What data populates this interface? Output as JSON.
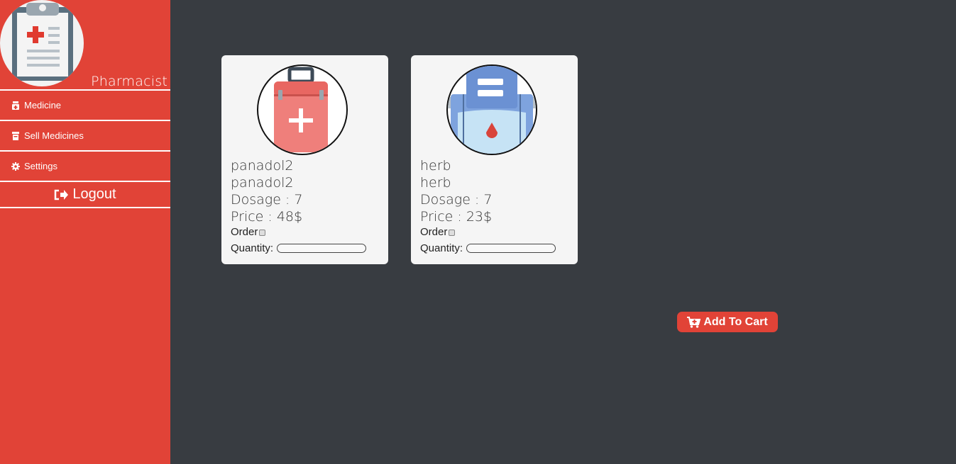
{
  "sidebar": {
    "role": "Pharmacist",
    "avatar_icon": "clipboard-medical-icon",
    "items": [
      {
        "label": "Medicine",
        "icon": "medicine-bottle-icon"
      },
      {
        "label": "Sell Medicines",
        "icon": "sell-medicines-icon"
      },
      {
        "label": "Settings",
        "icon": "gear-icon"
      }
    ],
    "logout": {
      "label": "Logout",
      "icon": "sign-out-icon"
    }
  },
  "products": [
    {
      "name": "panadol2",
      "generic": "panadol2",
      "dosage": "Dosage : 7",
      "price": "Price : 48$",
      "order_label": "Order",
      "quantity_label": "Quantity:",
      "icon": "first-aid-kit-icon"
    },
    {
      "name": "herb",
      "generic": "herb",
      "dosage": "Dosage : 7",
      "price": "Price : 23$",
      "order_label": "Order",
      "quantity_label": "Quantity:",
      "icon": "blood-bag-icon"
    }
  ],
  "cart": {
    "label": "Add To Cart",
    "icon": "cart-plus-icon"
  },
  "colors": {
    "accent": "#e14337",
    "background": "#383c41",
    "card": "#f5f5f5"
  }
}
